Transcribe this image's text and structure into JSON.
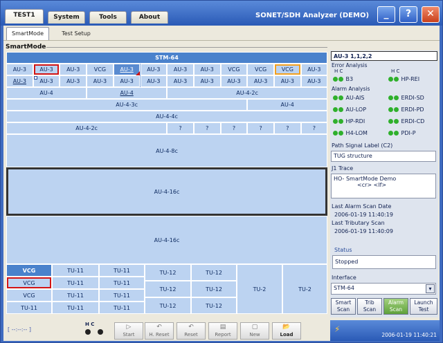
{
  "tabs": [
    "TEST1",
    "System",
    "Tools",
    "About"
  ],
  "app_title": "SONET/SDH Analyzer (DEMO)",
  "window_buttons": {
    "minimize": "_",
    "help": "?",
    "close": "✕"
  },
  "subtabs": [
    "SmartMode",
    "Test Setup"
  ],
  "section_title": "SmartMode",
  "grid": {
    "stm": "STM-64",
    "row1": [
      "AU-3",
      "AU-3",
      "AU-3",
      "VCG",
      "AU-3",
      "AU-3",
      "AU-3",
      "AU-3",
      "VCG",
      "VCG",
      "VCG",
      "AU-3"
    ],
    "row2": [
      "AU-3",
      "AU-3",
      "AU-3",
      "AU-3",
      "AU-3",
      "AU-3",
      "AU-3",
      "AU-3",
      "AU-3",
      "AU-3",
      "AU-3",
      "AU-3"
    ],
    "row3": [
      "AU-4",
      "AU-4",
      "AU-4-2c"
    ],
    "row4": [
      "AU-4-3c",
      "AU-4"
    ],
    "row5": "AU-4-4c",
    "row6": [
      "AU-4-2c",
      "?",
      "?",
      "?",
      "?",
      "?",
      "?"
    ],
    "row7": "AU-4-8c",
    "row8": "AU-4-16c",
    "row9": "AU-4-16c",
    "tu_col1": [
      "VCG",
      "VCG",
      "VCG",
      "TU-11"
    ],
    "tu_col2": [
      "TU-11",
      "TU-11",
      "TU-11",
      "TU-11"
    ],
    "tu_col3": [
      "TU-11",
      "TU-11",
      "TU-11",
      "TU-11"
    ],
    "tu_col4": [
      "TU-12",
      "TU-12",
      "TU-12"
    ],
    "tu_col5": [
      "TU-12",
      "TU-12",
      "TU-12"
    ],
    "tu_col6": "TU-2",
    "tu_col7": "TU-2"
  },
  "side": {
    "channel": "AU-3 1,1,2,2",
    "error_analysis": "Error Analysis",
    "hc": "H  C",
    "errors": [
      "B3",
      "HP-REI"
    ],
    "alarm_analysis": "Alarm Analysis",
    "alarms_left": [
      "AU-AIS",
      "AU-LOP",
      "HP-RDI",
      "H4-LOM"
    ],
    "alarms_right": [
      "ERDI-SD",
      "ERDI-PD",
      "ERDI-CD",
      "PDI-P"
    ],
    "psl_label": "Path Signal Label (C2)",
    "psl_value": "TUG structure",
    "j1_label": "J1 Trace",
    "j1_line1": "HO- SmartMode Demo",
    "j1_line2": "<cr> <lf>",
    "last_alarm_label": "Last Alarm Scan Date",
    "last_alarm_value": "2006-01-19 11:40:19",
    "last_trib_label": "Last Tributary Scan",
    "last_trib_value": "2006-01-19 11:40:09",
    "status_label": "Status",
    "status_value": "Stopped",
    "interface_label": "Interface",
    "interface_value": "STM-64",
    "buttons": [
      [
        "Smart",
        "Scan"
      ],
      [
        "Trib",
        "Scan"
      ],
      [
        "Alarm",
        "Scan"
      ],
      [
        "Launch",
        "Test"
      ]
    ]
  },
  "bottom": {
    "indicator": "[ --:--:-- ]",
    "hc": "H   C",
    "tools": [
      [
        "▷",
        "Start"
      ],
      [
        "↶",
        "H. Reset"
      ],
      [
        "↶",
        "Reset"
      ],
      [
        "▤",
        "Report"
      ],
      [
        "▢",
        "New"
      ],
      [
        "📂",
        "Load"
      ]
    ],
    "clock": "2006-01-19 11:40:21"
  },
  "colors": {
    "accent": "#4a82cc",
    "alarm_ok": "#2fb02c",
    "highlight_red": "#d21414",
    "highlight_orange": "#f2a020"
  }
}
